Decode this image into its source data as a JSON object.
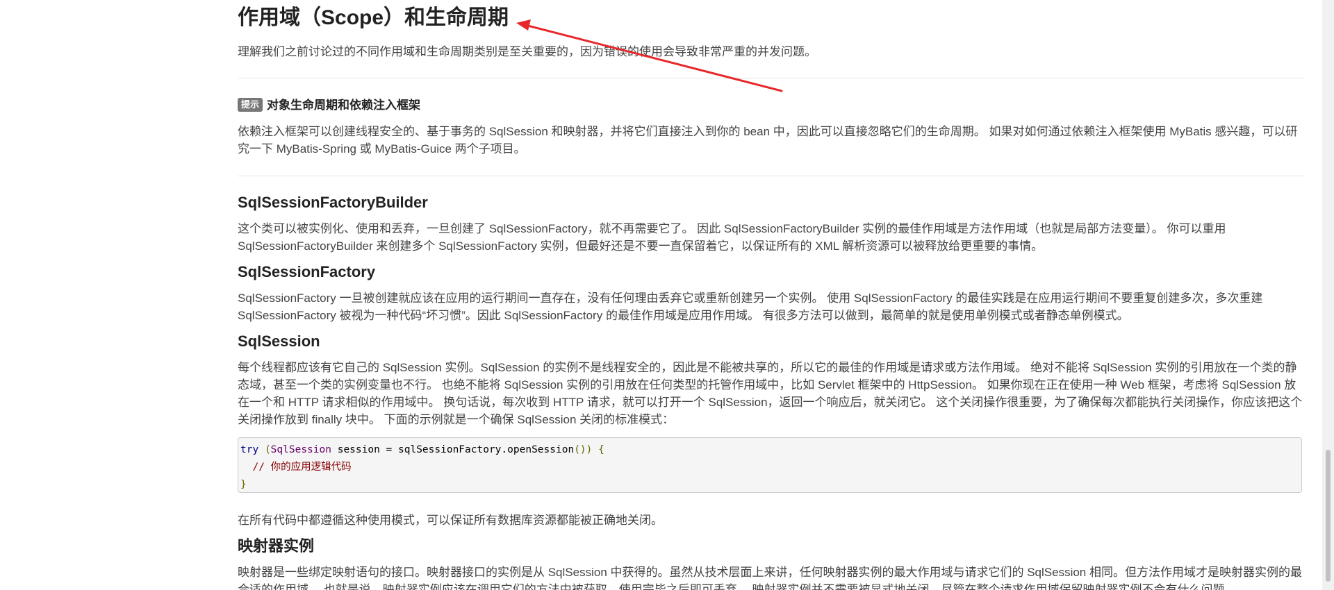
{
  "title": "作用域（Scope）和生命周期",
  "intro": "理解我们之前讨论过的不同作用域和生命周期类别是至关重要的，因为错误的使用会导致非常严重的并发问题。",
  "tip": {
    "badge": "提示",
    "heading": "对象生命周期和依赖注入框架",
    "text": "依赖注入框架可以创建线程安全的、基于事务的 SqlSession 和映射器，并将它们直接注入到你的 bean 中，因此可以直接忽略它们的生命周期。 如果对如何通过依赖注入框架使用 MyBatis 感兴趣，可以研究一下 MyBatis-Spring 或 MyBatis-Guice 两个子项目。"
  },
  "sections": [
    {
      "heading": "SqlSessionFactoryBuilder",
      "text": "这个类可以被实例化、使用和丢弃，一旦创建了 SqlSessionFactory，就不再需要它了。 因此 SqlSessionFactoryBuilder 实例的最佳作用域是方法作用域（也就是局部方法变量）。 你可以重用 SqlSessionFactoryBuilder 来创建多个 SqlSessionFactory 实例，但最好还是不要一直保留着它，以保证所有的 XML 解析资源可以被释放给更重要的事情。"
    },
    {
      "heading": "SqlSessionFactory",
      "text": "SqlSessionFactory 一旦被创建就应该在应用的运行期间一直存在，没有任何理由丢弃它或重新创建另一个实例。 使用 SqlSessionFactory 的最佳实践是在应用运行期间不要重复创建多次，多次重建 SqlSessionFactory 被视为一种代码“坏习惯”。因此 SqlSessionFactory 的最佳作用域是应用作用域。 有很多方法可以做到，最简单的就是使用单例模式或者静态单例模式。"
    },
    {
      "heading": "SqlSession",
      "text": "每个线程都应该有它自己的 SqlSession 实例。SqlSession 的实例不是线程安全的，因此是不能被共享的，所以它的最佳的作用域是请求或方法作用域。 绝对不能将 SqlSession 实例的引用放在一个类的静态域，甚至一个类的实例变量也不行。 也绝不能将 SqlSession 实例的引用放在任何类型的托管作用域中，比如 Servlet 框架中的 HttpSession。 如果你现在正在使用一种 Web 框架，考虑将 SqlSession 放在一个和 HTTP 请求相似的作用域中。 换句话说，每次收到 HTTP 请求，就可以打开一个 SqlSession，返回一个响应后，就关闭它。 这个关闭操作很重要，为了确保每次都能执行关闭操作，你应该把这个关闭操作放到 finally 块中。 下面的示例就是一个确保 SqlSession 关闭的标准模式："
    }
  ],
  "code": {
    "kw_try": "try",
    "sp1": " ",
    "open_paren": "(",
    "type": "SqlSession",
    "rest1": " session = sqlSessionFactory.openSession",
    "parens": "())",
    "brace_open": " {",
    "comment": "// 你的应用逻辑代码",
    "brace_close": "}"
  },
  "after_code": "在所有代码中都遵循这种使用模式，可以保证所有数据库资源都能被正确地关闭。",
  "mapper": {
    "heading": "映射器实例",
    "text": "映射器是一些绑定映射语句的接口。映射器接口的实例是从 SqlSession 中获得的。虽然从技术层面上来讲，任何映射器实例的最大作用域与请求它们的 SqlSession 相同。但方法作用域才是映射器实例的最合适的作用域。 也就是说，映射器实例应该在调用它们的方法中被获取，使用完毕之后即可丢弃。 映射器实例并不需要被显式地关闭。尽管在整个请求作用域保留映射器实例不会有什么问题，"
  },
  "colors": {
    "annotation_arrow": "#e8272a",
    "badge": "#777777"
  }
}
